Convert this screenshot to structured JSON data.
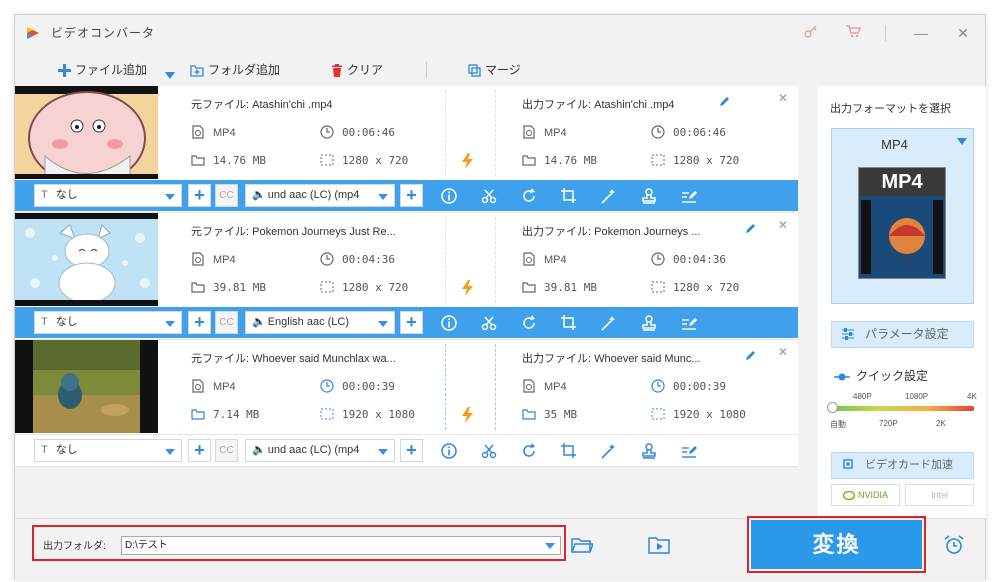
{
  "app": {
    "title": "ビデオコンバータ"
  },
  "toolbar": {
    "add_file": "ファイル追加",
    "add_folder": "フォルダ追加",
    "clear": "クリア",
    "merge": "マージ"
  },
  "items": [
    {
      "src_name": "元ファイル: Atashin'chi .mp4",
      "out_name": "出力ファイル: Atashin'chi .mp4",
      "src": {
        "format": "MP4",
        "duration": "00:06:46",
        "size": "14.76 MB",
        "resolution": "1280 x 720"
      },
      "out": {
        "format": "MP4",
        "duration": "00:06:46",
        "size": "14.76 MB",
        "resolution": "1280 x 720"
      },
      "subtitle": "なし",
      "audio": "und aac (LC) (mp4"
    },
    {
      "src_name": "元ファイル: Pokemon Journeys Just Re...",
      "out_name": "出力ファイル: Pokemon Journeys ...",
      "src": {
        "format": "MP4",
        "duration": "00:04:36",
        "size": "39.81 MB",
        "resolution": "1280 x 720"
      },
      "out": {
        "format": "MP4",
        "duration": "00:04:36",
        "size": "39.81 MB",
        "resolution": "1280 x 720"
      },
      "subtitle": "なし",
      "audio": "English aac (LC)"
    },
    {
      "src_name": "元ファイル: Whoever said Munchlax wa...",
      "out_name": "出力ファイル: Whoever said Munc...",
      "src": {
        "format": "MP4",
        "duration": "00:00:39",
        "size": "7.14 MB",
        "resolution": "1920 x 1080"
      },
      "out": {
        "format": "MP4",
        "duration": "00:00:39",
        "size": "35 MB",
        "resolution": "1920 x 1080"
      },
      "subtitle": "なし",
      "audio": "und aac (LC) (mp4"
    }
  ],
  "right_panel": {
    "format_title": "出力フォーマットを選択",
    "format_name": "MP4",
    "format_badge": "MP4",
    "param_button": "パラメータ設定",
    "quick_title": "クイック設定",
    "quality_top": [
      "480P",
      "1080P",
      "4K"
    ],
    "quality_bottom": [
      "自動",
      "720P",
      "2K"
    ],
    "hw_button": "ビデオカード加速",
    "gpu_nvidia": "NVIDIA",
    "gpu_intel": "Intel"
  },
  "bottom": {
    "out_label": "出力フォルダ:",
    "out_path": "D:\\テスト",
    "convert": "変換"
  },
  "colors": {
    "accent": "#3fa1ec",
    "highlight": "#d9262c",
    "bolt": "#f39c1f"
  }
}
